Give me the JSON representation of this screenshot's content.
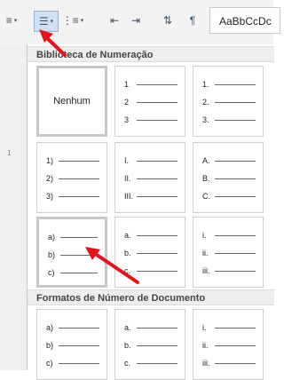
{
  "ribbon": {
    "style_preview": "AaBbCcDc"
  },
  "ruler": {
    "mark": "1"
  },
  "library": {
    "title": "Biblioteca de Numeração",
    "none_label": "Nenhum",
    "tiles": [
      {
        "rows": [
          "1",
          "2",
          "3"
        ]
      },
      {
        "rows": [
          "1.",
          "2.",
          "3."
        ]
      },
      {
        "rows": [
          "1)",
          "2)",
          "3)"
        ]
      },
      {
        "rows": [
          "I.",
          "II.",
          "III."
        ]
      },
      {
        "rows": [
          "A.",
          "B.",
          "C."
        ]
      },
      {
        "rows": [
          "a)",
          "b)",
          "c)"
        ]
      },
      {
        "rows": [
          "a.",
          "b.",
          "c."
        ]
      },
      {
        "rows": [
          "i.",
          "ii.",
          "iii."
        ]
      }
    ]
  },
  "document_formats": {
    "title": "Formatos de Número de Documento",
    "tiles": [
      {
        "rows": [
          "a)",
          "b)",
          "c)"
        ]
      },
      {
        "rows": [
          "a.",
          "b.",
          "c."
        ]
      },
      {
        "rows": [
          "i.",
          "ii.",
          "iii."
        ]
      }
    ]
  },
  "colors": {
    "annotation_arrow": "#e3141b",
    "panel_header_bg": "#eeeeee",
    "selected_border": "#c8c8c8"
  }
}
